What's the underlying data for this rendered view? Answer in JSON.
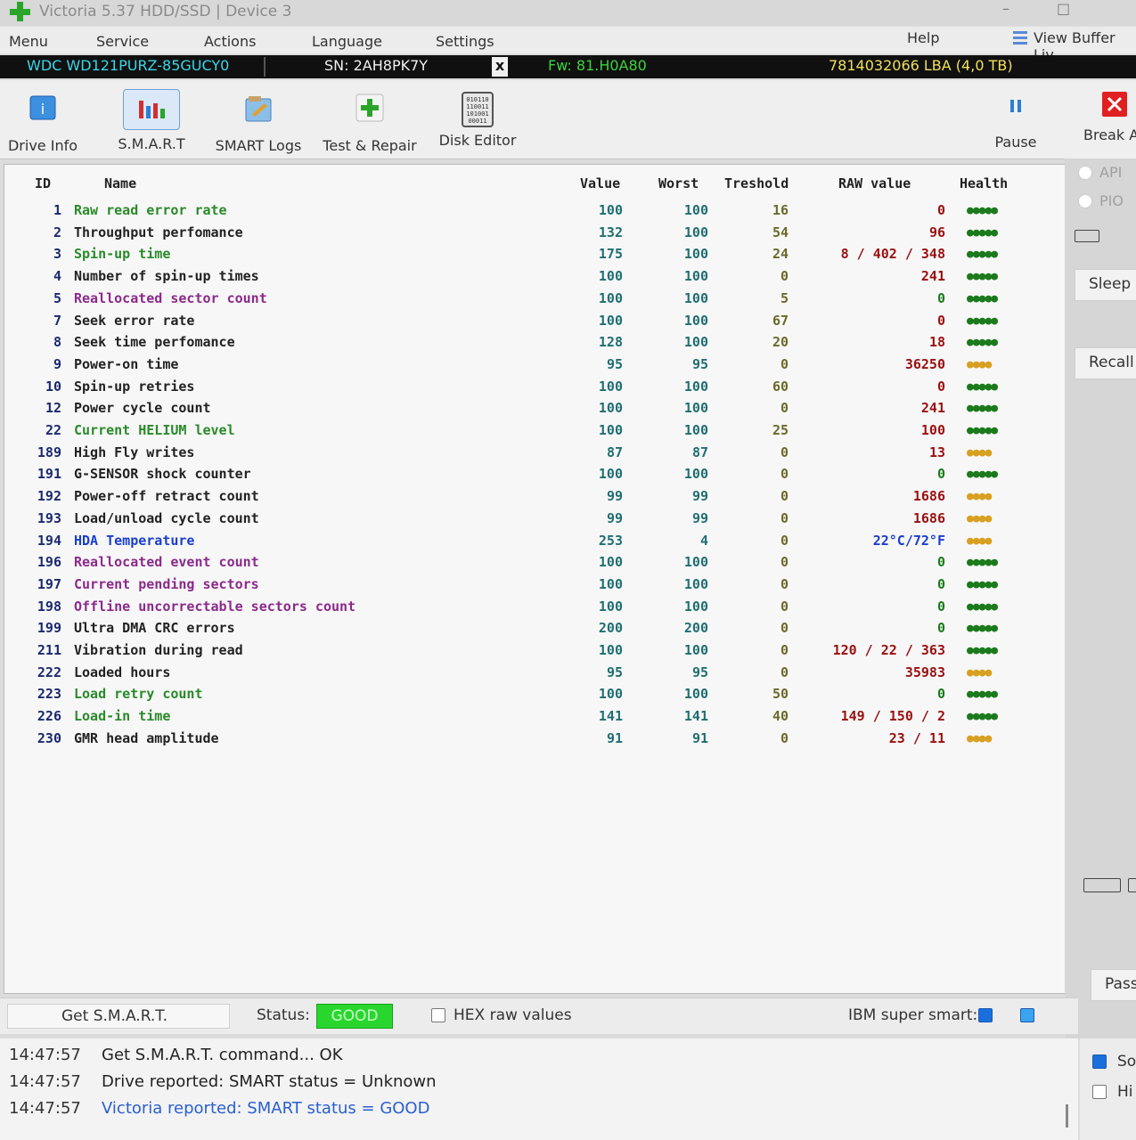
{
  "window": {
    "title": "Victoria 5.37 HDD/SSD | Device 3",
    "controls": {
      "minimize": "–",
      "maximize": "□"
    }
  },
  "menu": {
    "items": [
      "Menu",
      "Service",
      "Actions",
      "Language",
      "Settings"
    ],
    "help": "Help",
    "view_buffer": "View Buffer Liv"
  },
  "drive": {
    "model": "WDC WD121PURZ-85GUCY0",
    "serial": "SN: 2AH8PK7Y",
    "close": "x",
    "firmware": "Fw: 81.H0A80",
    "lba": "7814032066 LBA (4,0 TB)"
  },
  "toolbar": {
    "drive_info": "Drive Info",
    "smart": "S.M.A.R.T",
    "smart_logs": "SMART Logs",
    "test_repair": "Test & Repair",
    "disk_editor": "Disk Editor",
    "pause": "Pause",
    "break": "Break A"
  },
  "smart_table": {
    "headers": {
      "id": "ID",
      "name": "Name",
      "value": "Value",
      "worst": "Worst",
      "threshold": "Treshold",
      "raw": "RAW value",
      "health": "Health"
    },
    "rows": [
      {
        "id": "1",
        "name": "Raw read error rate",
        "value": "100",
        "worst": "100",
        "threshold": "16",
        "raw": "0",
        "health": "●●●●●",
        "name_color": "#2a8a2a",
        "raw_color": "#9a1010",
        "health_color": "#1b7a1b"
      },
      {
        "id": "2",
        "name": "Throughput perfomance",
        "value": "132",
        "worst": "100",
        "threshold": "54",
        "raw": "96",
        "health": "●●●●●",
        "name_color": "#222222",
        "raw_color": "#9a1010",
        "health_color": "#1b7a1b"
      },
      {
        "id": "3",
        "name": "Spin-up time",
        "value": "175",
        "worst": "100",
        "threshold": "24",
        "raw": "8 / 402 / 348",
        "health": "●●●●●",
        "name_color": "#2a8a2a",
        "raw_color": "#9a1010",
        "health_color": "#1b7a1b"
      },
      {
        "id": "4",
        "name": "Number of spin-up times",
        "value": "100",
        "worst": "100",
        "threshold": "0",
        "raw": "241",
        "health": "●●●●●",
        "name_color": "#222222",
        "raw_color": "#9a1010",
        "health_color": "#1b7a1b"
      },
      {
        "id": "5",
        "name": "Reallocated sector count",
        "value": "100",
        "worst": "100",
        "threshold": "5",
        "raw": "0",
        "health": "●●●●●",
        "name_color": "#8b2a8b",
        "raw_color": "#1b7a1b",
        "health_color": "#1b7a1b"
      },
      {
        "id": "7",
        "name": "Seek error rate",
        "value": "100",
        "worst": "100",
        "threshold": "67",
        "raw": "0",
        "health": "●●●●●",
        "name_color": "#222222",
        "raw_color": "#9a1010",
        "health_color": "#1b7a1b"
      },
      {
        "id": "8",
        "name": "Seek time perfomance",
        "value": "128",
        "worst": "100",
        "threshold": "20",
        "raw": "18",
        "health": "●●●●●",
        "name_color": "#222222",
        "raw_color": "#9a1010",
        "health_color": "#1b7a1b"
      },
      {
        "id": "9",
        "name": "Power-on time",
        "value": "95",
        "worst": "95",
        "threshold": "0",
        "raw": "36250",
        "health": "●●●●",
        "name_color": "#222222",
        "raw_color": "#9a1010",
        "health_color": "#d8a020"
      },
      {
        "id": "10",
        "name": "Spin-up retries",
        "value": "100",
        "worst": "100",
        "threshold": "60",
        "raw": "0",
        "health": "●●●●●",
        "name_color": "#222222",
        "raw_color": "#9a1010",
        "health_color": "#1b7a1b"
      },
      {
        "id": "12",
        "name": "Power cycle count",
        "value": "100",
        "worst": "100",
        "threshold": "0",
        "raw": "241",
        "health": "●●●●●",
        "name_color": "#222222",
        "raw_color": "#9a1010",
        "health_color": "#1b7a1b"
      },
      {
        "id": "22",
        "name": "Current HELIUM level",
        "value": "100",
        "worst": "100",
        "threshold": "25",
        "raw": "100",
        "health": "●●●●●",
        "name_color": "#2a8a2a",
        "raw_color": "#9a1010",
        "health_color": "#1b7a1b"
      },
      {
        "id": "189",
        "name": "High Fly writes",
        "value": "87",
        "worst": "87",
        "threshold": "0",
        "raw": "13",
        "health": "●●●●",
        "name_color": "#222222",
        "raw_color": "#9a1010",
        "health_color": "#d8a020"
      },
      {
        "id": "191",
        "name": "G-SENSOR shock counter",
        "value": "100",
        "worst": "100",
        "threshold": "0",
        "raw": "0",
        "health": "●●●●●",
        "name_color": "#222222",
        "raw_color": "#1b7a1b",
        "health_color": "#1b7a1b"
      },
      {
        "id": "192",
        "name": "Power-off retract count",
        "value": "99",
        "worst": "99",
        "threshold": "0",
        "raw": "1686",
        "health": "●●●●",
        "name_color": "#222222",
        "raw_color": "#9a1010",
        "health_color": "#d8a020"
      },
      {
        "id": "193",
        "name": "Load/unload cycle count",
        "value": "99",
        "worst": "99",
        "threshold": "0",
        "raw": "1686",
        "health": "●●●●",
        "name_color": "#222222",
        "raw_color": "#9a1010",
        "health_color": "#d8a020"
      },
      {
        "id": "194",
        "name": "HDA Temperature",
        "value": "253",
        "worst": "4",
        "threshold": "0",
        "raw": "22°C/72°F",
        "health": "●●●●",
        "name_color": "#1a3fcf",
        "raw_color": "#1a3fcf",
        "health_color": "#d8a020"
      },
      {
        "id": "196",
        "name": "Reallocated event count",
        "value": "100",
        "worst": "100",
        "threshold": "0",
        "raw": "0",
        "health": "●●●●●",
        "name_color": "#8b2a8b",
        "raw_color": "#1b7a1b",
        "health_color": "#1b7a1b"
      },
      {
        "id": "197",
        "name": "Current pending sectors",
        "value": "100",
        "worst": "100",
        "threshold": "0",
        "raw": "0",
        "health": "●●●●●",
        "name_color": "#8b2a8b",
        "raw_color": "#1b7a1b",
        "health_color": "#1b7a1b"
      },
      {
        "id": "198",
        "name": "Offline uncorrectable sectors count",
        "value": "100",
        "worst": "100",
        "threshold": "0",
        "raw": "0",
        "health": "●●●●●",
        "name_color": "#8b2a8b",
        "raw_color": "#1b7a1b",
        "health_color": "#1b7a1b"
      },
      {
        "id": "199",
        "name": "Ultra DMA CRC errors",
        "value": "200",
        "worst": "200",
        "threshold": "0",
        "raw": "0",
        "health": "●●●●●",
        "name_color": "#222222",
        "raw_color": "#1b7a1b",
        "health_color": "#1b7a1b"
      },
      {
        "id": "211",
        "name": "Vibration during read",
        "value": "100",
        "worst": "100",
        "threshold": "0",
        "raw": "120 / 22 / 363",
        "health": "●●●●●",
        "name_color": "#222222",
        "raw_color": "#9a1010",
        "health_color": "#1b7a1b"
      },
      {
        "id": "222",
        "name": "Loaded hours",
        "value": "95",
        "worst": "95",
        "threshold": "0",
        "raw": "35983",
        "health": "●●●●",
        "name_color": "#222222",
        "raw_color": "#9a1010",
        "health_color": "#d8a020"
      },
      {
        "id": "223",
        "name": "Load retry count",
        "value": "100",
        "worst": "100",
        "threshold": "50",
        "raw": "0",
        "health": "●●●●●",
        "name_color": "#2a8a2a",
        "raw_color": "#1b7a1b",
        "health_color": "#1b7a1b"
      },
      {
        "id": "226",
        "name": "Load-in time",
        "value": "141",
        "worst": "141",
        "threshold": "40",
        "raw": "149 / 150 / 2",
        "health": "●●●●●",
        "name_color": "#2a8a2a",
        "raw_color": "#9a1010",
        "health_color": "#1b7a1b"
      },
      {
        "id": "230",
        "name": "GMR head amplitude",
        "value": "91",
        "worst": "91",
        "threshold": "0",
        "raw": "23 / 11",
        "health": "●●●●",
        "name_color": "#222222",
        "raw_color": "#9a1010",
        "health_color": "#d8a020"
      }
    ]
  },
  "sidebar": {
    "api": "API",
    "pio": "PIO",
    "sleep": "Sleep",
    "recall": "Recall",
    "pass": "Pass"
  },
  "statusbar": {
    "get_smart": "Get S.M.A.R.T.",
    "status_label": "Status:",
    "status_value": "GOOD",
    "hex_label": "HEX raw values",
    "ibm_label": "IBM super smart:"
  },
  "log": {
    "lines": [
      {
        "time": "14:47:57",
        "msg": "Get S.M.A.R.T. command... OK",
        "color": "#333333"
      },
      {
        "time": "14:47:57",
        "msg": "Drive reported: SMART status = Unknown",
        "color": "#333333"
      },
      {
        "time": "14:47:57",
        "msg": "Victoria reported: SMART status = GOOD",
        "color": "#2a5fd0"
      }
    ],
    "side_check_1": "So",
    "side_check_2": "Hi"
  },
  "colors": {
    "accent_green": "#29d62e",
    "drive_model": "#3ad6e8",
    "firmware": "#3cd33c",
    "lba": "#f0e05a",
    "break_red": "#e02020"
  }
}
